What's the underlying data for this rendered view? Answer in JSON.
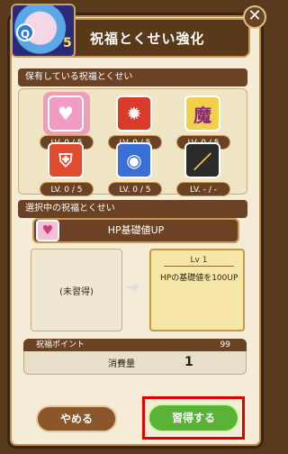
{
  "header": {
    "title": "祝福とくせい強化",
    "close_label": "✕",
    "avatar_badge": "Q"
  },
  "owned_section": {
    "title": "保有している祝福とくせい"
  },
  "skills": [
    {
      "icon": "heart-arrow-icon",
      "level": "LV. 0 / 5",
      "color": "#f29bc4",
      "glyph": "♥"
    },
    {
      "icon": "flame-arrow-icon",
      "level": "LV. 0 / 5",
      "color": "#d93b2a",
      "glyph": "🔥"
    },
    {
      "icon": "magic-arrow-icon",
      "level": "LV. 0 / 5",
      "color": "#f2d14a",
      "glyph": "魔"
    },
    {
      "icon": "flame-shield-icon",
      "level": "LV. 0 / 5",
      "color": "#e14b2f",
      "glyph": "🛡"
    },
    {
      "icon": "eye-star-icon",
      "level": "LV. 0 / 5",
      "color": "#3b6fd8",
      "glyph": "◉"
    },
    {
      "icon": "slash-icon",
      "level": "LV. - / -",
      "color": "#2b2b2b",
      "glyph": "／"
    }
  ],
  "selected_section": {
    "title": "選択中の祝福とくせい",
    "skill_name": "HP基礎値UP"
  },
  "current_level": {
    "label": "(未習得)"
  },
  "next_level": {
    "title": "Lv 1",
    "description": "HPの基礎値を100UP"
  },
  "points": {
    "label": "祝福ポイント",
    "value": "99",
    "cost_label": "消費量",
    "cost_value": "1"
  },
  "buttons": {
    "cancel_label": "やめる",
    "learn_label": "習得する"
  },
  "colors": {
    "accent": "#6b4324",
    "highlight": "#e10000",
    "learn_button": "#58b336"
  }
}
